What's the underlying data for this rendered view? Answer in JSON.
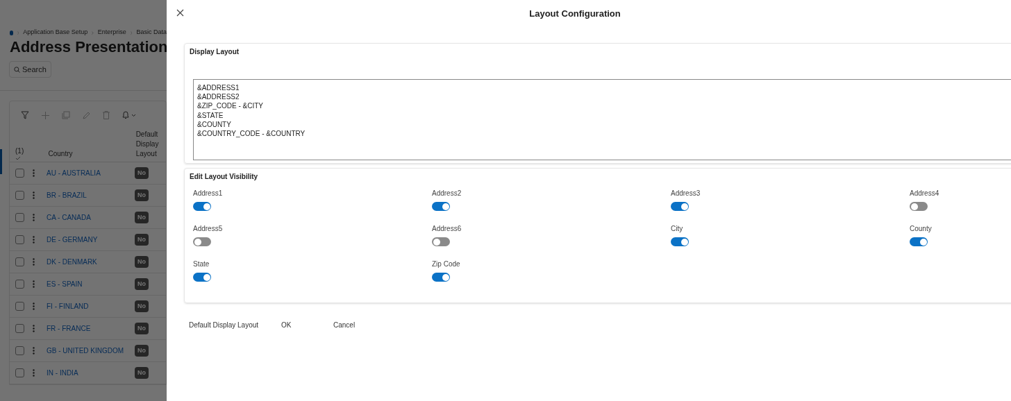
{
  "background_page": {
    "breadcrumb": [
      "Application Base Setup",
      "Enterprise",
      "Basic Data"
    ],
    "title": "Address Presentation",
    "search_button": "Search",
    "table": {
      "selection_count": "(1)",
      "columns": [
        "Country",
        "Default Display Layout"
      ],
      "rows": [
        {
          "country": "AU - AUSTRALIA",
          "default": "No",
          "checked": false
        },
        {
          "country": "BR - BRAZIL",
          "default": "No",
          "checked": false
        },
        {
          "country": "CA - CANADA",
          "default": "No",
          "checked": false
        },
        {
          "country": "DE - GERMANY",
          "default": "No",
          "checked": false
        },
        {
          "country": "DK - DENMARK",
          "default": "No",
          "checked": false
        },
        {
          "country": "ES - SPAIN",
          "default": "No",
          "checked": false
        },
        {
          "country": "FI - FINLAND",
          "default": "No",
          "checked": false
        },
        {
          "country": "FR - FRANCE",
          "default": "No",
          "checked": false
        },
        {
          "country": "GB - UNITED KINGDOM",
          "default": "No",
          "checked": false
        },
        {
          "country": "IN - INDIA",
          "default": "No",
          "checked": false
        }
      ]
    }
  },
  "dialog": {
    "title": "Layout Configuration",
    "display_layout": {
      "heading": "Display Layout",
      "value": "&ADDRESS1\n&ADDRESS2\n&ZIP_CODE - &CITY\n&STATE\n&COUNTY\n&COUNTRY_CODE - &COUNTRY"
    },
    "visibility": {
      "heading": "Edit Layout Visibility",
      "toggles": [
        {
          "label": "Address1",
          "on": true
        },
        {
          "label": "Address2",
          "on": true
        },
        {
          "label": "Address3",
          "on": true
        },
        {
          "label": "Address4",
          "on": false
        },
        {
          "label": "Address5",
          "on": false
        },
        {
          "label": "Address6",
          "on": false
        },
        {
          "label": "City",
          "on": true
        },
        {
          "label": "County",
          "on": true
        },
        {
          "label": "State",
          "on": true
        },
        {
          "label": "Zip Code",
          "on": true
        }
      ]
    },
    "buttons": [
      "Default Display Layout",
      "OK",
      "Cancel"
    ]
  }
}
